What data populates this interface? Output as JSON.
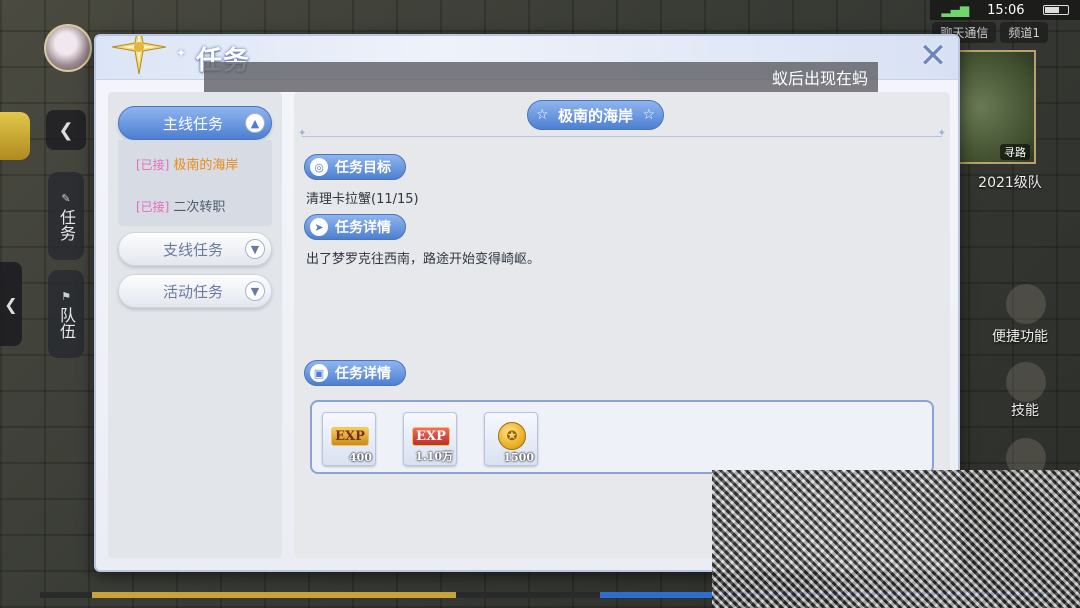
{
  "status_bar": {
    "time": "15:06"
  },
  "hud": {
    "task_tab_label": "任务",
    "team_tab_label": "队伍",
    "top_tabs": [
      "聊天通信",
      "频道1"
    ],
    "minimap_find": "寻路",
    "right_labels": [
      "2021级队",
      "便捷功能",
      "技能"
    ]
  },
  "panel": {
    "title": "任务",
    "announcement": "蚁后出现在蚂",
    "categories": {
      "main": "主线任务",
      "side": "支线任务",
      "event": "活动任务"
    },
    "quest_list": [
      {
        "tag": "[已接]",
        "name": "极南的海岸"
      },
      {
        "tag": "[已接]",
        "name": "二次转职"
      }
    ],
    "quest": {
      "title": "极南的海岸",
      "goal_header": "任务目标",
      "goal_text": "清理卡拉蟹(11/15)",
      "detail_header": "任务详情",
      "detail_text": "出了梦罗克往西南，路途开始变得崎岖。",
      "reward_header": "任务详情"
    },
    "rewards": [
      {
        "icon": "exp-icon",
        "label": "EXP",
        "quantity": "400"
      },
      {
        "icon": "exp-boost-icon",
        "label": "EXP",
        "quantity": "1.10万"
      },
      {
        "icon": "gold-coin-icon",
        "label": "",
        "quantity": "1500"
      }
    ]
  },
  "colors": {
    "accent_blue": "#4d7fd1",
    "quest_name_orange": "#e98a1a",
    "accepted_tag_pink": "#e56bb9"
  }
}
